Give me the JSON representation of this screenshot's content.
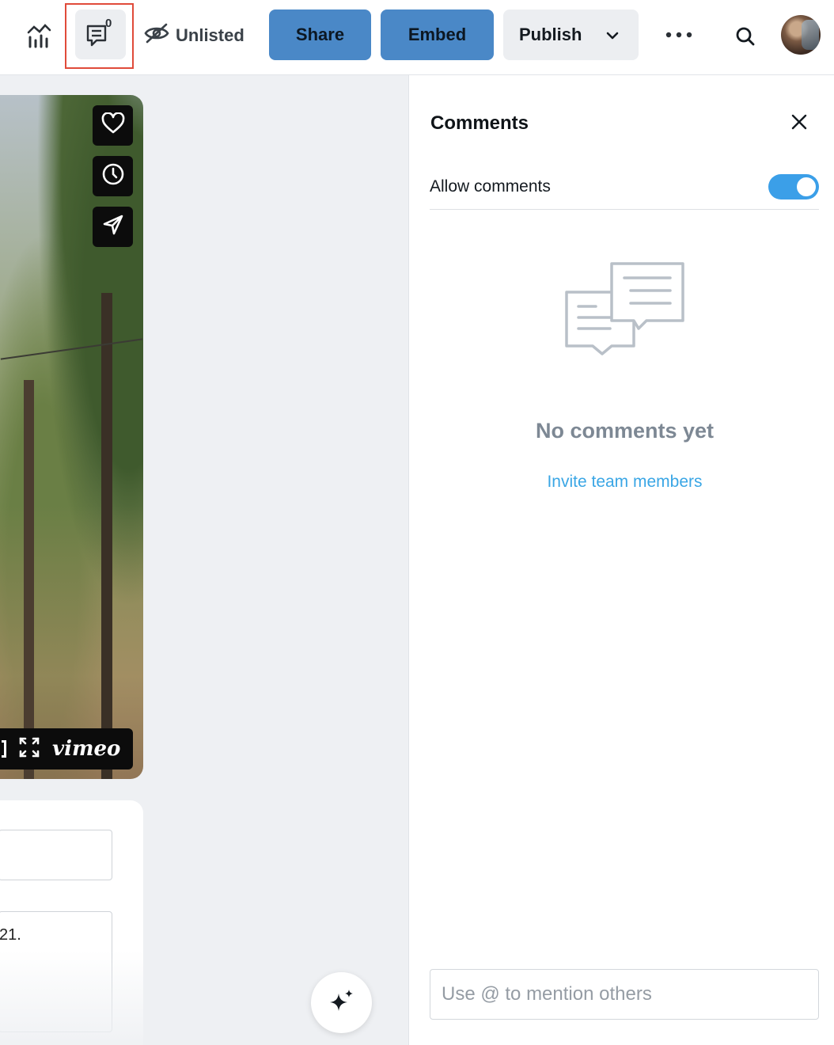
{
  "topbar": {
    "privacy_label": "Unlisted",
    "share_label": "Share",
    "embed_label": "Embed",
    "publish_label": "Publish",
    "comment_count": "0",
    "icons": [
      "analytics-icon",
      "comments-icon",
      "eye-off-icon",
      "chevron-down-icon",
      "more-icon",
      "search-icon"
    ]
  },
  "video": {
    "brand": "vimeo",
    "side_actions": [
      "like",
      "watch-later",
      "share"
    ],
    "icons": [
      "heart-icon",
      "clock-icon",
      "send-icon",
      "fullscreen-icon"
    ]
  },
  "card": {
    "field2_text_fragment": "21."
  },
  "panel": {
    "title": "Comments",
    "allow_label": "Allow comments",
    "allow_enabled": true,
    "empty_title": "No comments yet",
    "invite_label": "Invite team members",
    "input_placeholder": "Use @ to mention others"
  },
  "colors": {
    "accent_blue": "#4a88c7",
    "toggle_on": "#3b9fe8",
    "link": "#3aa6e5",
    "highlight": "#e04b3a"
  }
}
